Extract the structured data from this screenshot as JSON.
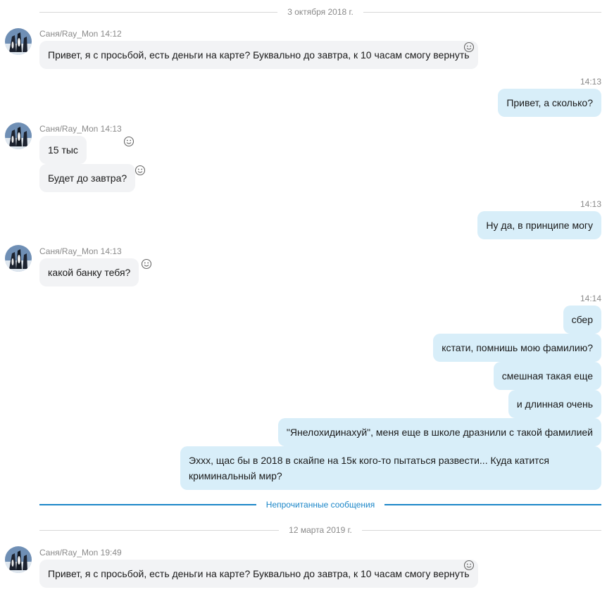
{
  "colors": {
    "incoming_bubble": "#f2f3f5",
    "outgoing_bubble": "#d8eef9",
    "accent": "#1b86c8"
  },
  "date1": "3 октября 2018 г.",
  "date2": "12 марта 2019 г.",
  "unread_label": "Непрочитанные сообщения",
  "msgs": {
    "m1": {
      "sender": "Саня/Ray_Mon",
      "time": "14:12",
      "text": "Привет, я с просьбой, есть деньги на карте? Буквально до завтра, к 10 часам смогу вернуть"
    },
    "m2": {
      "time": "14:13",
      "text": "Привет, а сколько?"
    },
    "m3": {
      "sender": "Саня/Ray_Mon",
      "time": "14:13",
      "text": "15 тыс"
    },
    "m4": {
      "text": "Будет до завтра?"
    },
    "m5": {
      "time": "14:13",
      "text": "Ну да, в принципе могу"
    },
    "m6": {
      "sender": "Саня/Ray_Mon",
      "time": "14:13",
      "text": "какой банку тебя?"
    },
    "m7": {
      "time": "14:14",
      "text": "сбер"
    },
    "m8": {
      "text": "кстати, помнишь мою фамилию?"
    },
    "m9": {
      "text": "смешная такая еще"
    },
    "m10": {
      "text": "и длинная очень"
    },
    "m11": {
      "text": "\"Янелохидинахуй\", меня еще в школе дразнили с такой фамилией"
    },
    "m12": {
      "text": "Эхxx, щас бы в 2018 в скайпе на 15к кого-то пытаться развести... Куда катится криминальный мир?"
    },
    "m13": {
      "sender": "Саня/Ray_Mon",
      "time": "19:49",
      "text": "Привет, я с просьбой, есть деньги на карте? Буквально до завтра, к 10 часам смогу вернуть"
    }
  }
}
